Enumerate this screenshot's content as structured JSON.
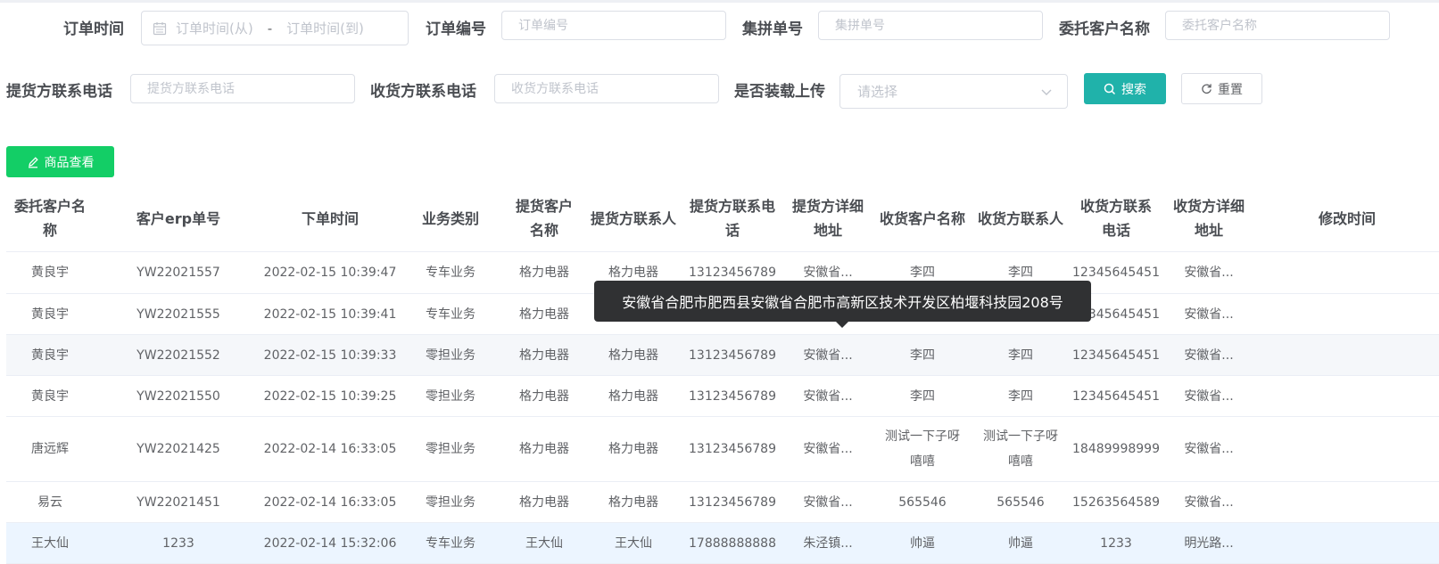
{
  "filters": {
    "order_time_label": "订单时间",
    "order_time_from": "订单时间(从)",
    "order_time_sep": "-",
    "order_time_to": "订单时间(到)",
    "order_no_label": "订单编号",
    "order_no_placeholder": "订单编号",
    "group_no_label": "集拼单号",
    "group_no_placeholder": "集拼单号",
    "client_label": "委托客户名称",
    "client_placeholder": "委托客户名称",
    "pickup_phone_label": "提货方联系电话",
    "pickup_phone_placeholder": "提货方联系电话",
    "receiver_phone_label": "收货方联系电话",
    "receiver_phone_placeholder": "收货方联系电话",
    "loaded_upload_label": "是否装载上传",
    "loaded_upload_placeholder": "请选择",
    "search_button": "搜索",
    "reset_button": "重置"
  },
  "toolbar": {
    "goods_view_button": "商品查看"
  },
  "table": {
    "columns": [
      "委托客户名称",
      "客户erp单号",
      "下单时间",
      "业务类别",
      "提货客户名称",
      "提货方联系人",
      "提货方联系电话",
      "提货方详细地址",
      "收货客户名称",
      "收货方联系人",
      "收货方联系电话",
      "收货方详细地址",
      "修改时间"
    ],
    "rows": [
      [
        "黄良宇",
        "YW22021557",
        "2022-02-15 10:39:47",
        "专车业务",
        "格力电器",
        "格力电器",
        "13123456789",
        "安徽省...",
        "李四",
        "李四",
        "12345645451",
        "安徽省...",
        ""
      ],
      [
        "黄良宇",
        "YW22021555",
        "2022-02-15 10:39:41",
        "专车业务",
        "格力电器",
        "",
        "",
        "",
        "",
        "",
        "12345645451",
        "安徽省...",
        ""
      ],
      [
        "黄良宇",
        "YW22021552",
        "2022-02-15 10:39:33",
        "零担业务",
        "格力电器",
        "格力电器",
        "13123456789",
        "安徽省...",
        "李四",
        "李四",
        "12345645451",
        "安徽省...",
        ""
      ],
      [
        "黄良宇",
        "YW22021550",
        "2022-02-15 10:39:25",
        "零担业务",
        "格力电器",
        "格力电器",
        "13123456789",
        "安徽省...",
        "李四",
        "李四",
        "12345645451",
        "安徽省...",
        ""
      ],
      [
        "唐远辉",
        "YW22021425",
        "2022-02-14 16:33:05",
        "零担业务",
        "格力电器",
        "格力电器",
        "13123456789",
        "安徽省...",
        "测试一下子呀嘻嘻",
        "测试一下子呀嘻嘻",
        "18489998999",
        "安徽省...",
        ""
      ],
      [
        "易云",
        "YW22021451",
        "2022-02-14 16:33:05",
        "零担业务",
        "格力电器",
        "格力电器",
        "13123456789",
        "安徽省...",
        "565546",
        "565546",
        "15263564589",
        "安徽省...",
        ""
      ],
      [
        "王大仙",
        "1233",
        "2022-02-14 15:32:06",
        "专车业务",
        "王大仙",
        "王大仙",
        "17888888888",
        "朱泾镇...",
        "帅逼",
        "帅逼",
        "1233",
        "明光路...",
        ""
      ]
    ]
  },
  "tooltip": {
    "text": "安徽省合肥市肥西县安徽省合肥市高新区技术开发区柏堰科技园208号"
  }
}
